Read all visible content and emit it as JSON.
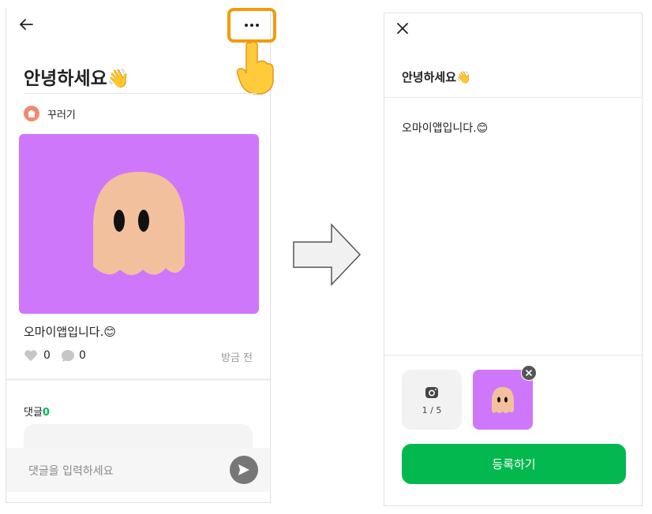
{
  "left": {
    "post_title": "안녕하세요👋",
    "author_name": "꾸러기",
    "post_body": "오마이앱입니다.😊",
    "like_count": "0",
    "comment_count": "0",
    "post_time": "방금 전",
    "comments_label": "댓글",
    "comments_count": "0",
    "comment_placeholder": "댓글을 입력하세요",
    "icons": [
      "back-arrow-icon",
      "more-icon",
      "pointing-hand-icon",
      "heart-icon",
      "speech-bubble-icon",
      "send-icon"
    ]
  },
  "right": {
    "title": "안녕하세요👋",
    "body": "오마이앱입니다.😊",
    "photo_counter": "1 / 5",
    "submit_label": "등록하기",
    "icons": [
      "close-icon",
      "camera-icon",
      "remove-photo-icon"
    ]
  },
  "colors": {
    "accent_green": "#03b84e",
    "highlight_orange": "#f59a0c",
    "image_background": "#cf77fb",
    "ghost": "#f3c09d"
  }
}
